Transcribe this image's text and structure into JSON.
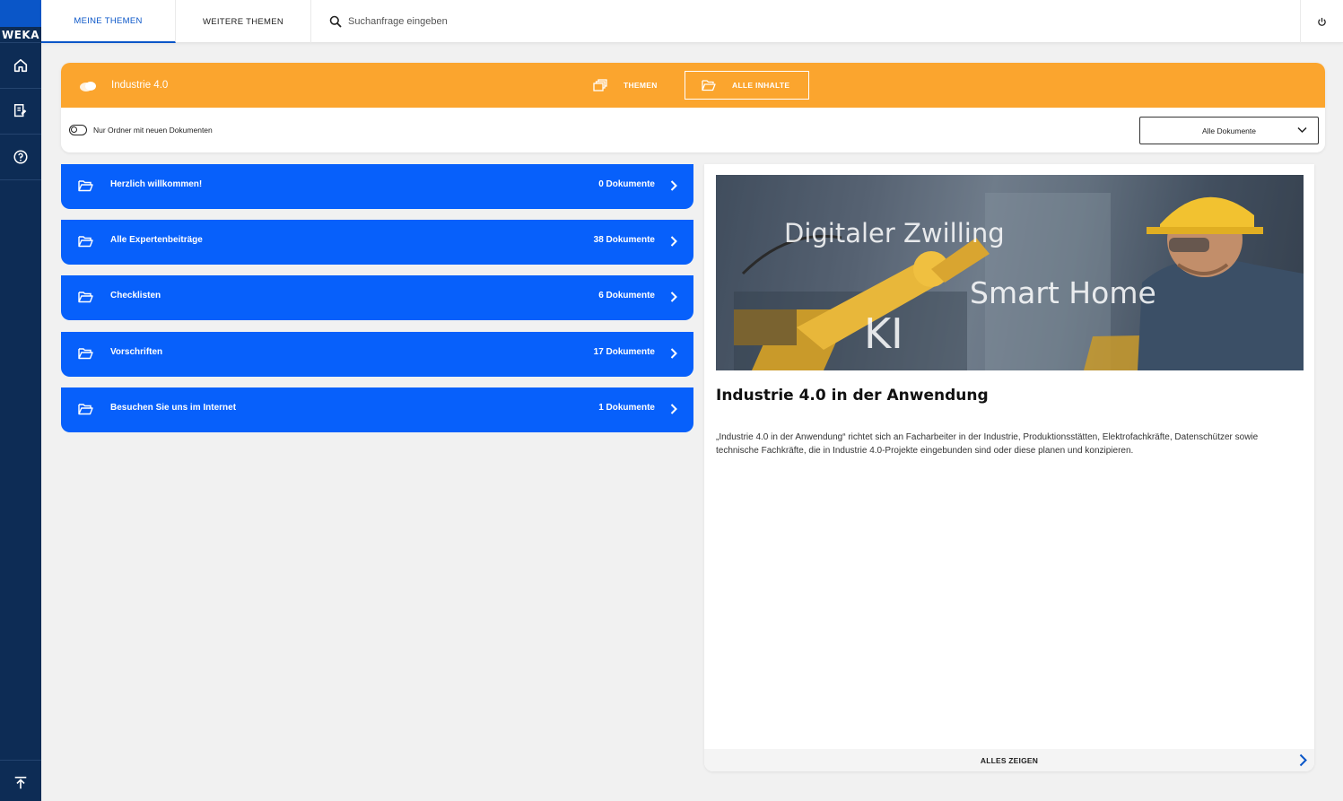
{
  "brand": {
    "logo_text": "WEKA"
  },
  "sidebar": {
    "items": [
      {
        "icon": "home-icon"
      },
      {
        "icon": "document-edit-icon"
      },
      {
        "icon": "help-icon"
      }
    ],
    "bottom_icon": "scroll-top-icon"
  },
  "topbar": {
    "tabs": [
      {
        "label": "MEINE THEMEN",
        "active": true
      },
      {
        "label": "WEITERE THEMEN",
        "active": false
      }
    ],
    "search_placeholder": "Suchanfrage eingeben",
    "power_icon": "power-icon"
  },
  "header": {
    "title": "Industrie 4.0",
    "themen_label": "THEMEN",
    "alle_inhalte_label": "ALLE INHALTE",
    "accent_color": "#fba52e"
  },
  "filter": {
    "toggle_label": "Nur Ordner mit neuen Dokumenten",
    "toggle_on": false,
    "dropdown_value": "Alle Dokumente"
  },
  "folders": [
    {
      "label": "Herzlich willkommen!",
      "count": "0 Dokumente"
    },
    {
      "label": "Alle Expertenbeiträge",
      "count": "38 Dokumente"
    },
    {
      "label": "Checklisten",
      "count": "6 Dokumente"
    },
    {
      "label": "Vorschriften",
      "count": "17 Dokumente"
    },
    {
      "label": "Besuchen Sie uns im Internet",
      "count": "1 Dokumente"
    }
  ],
  "folder_color": "#0760fb",
  "detail": {
    "image_words": [
      "Digitaler Zwilling",
      "Smart Home",
      "KI"
    ],
    "title": "Industrie 4.0 in der Anwendung",
    "description": "„Industrie 4.0 in der Anwendung“ richtet sich an Facharbeiter in der Industrie, Produktionsstätten, Elektrofachkräfte, Datenschützer sowie technische Fachkräfte, die in Industrie 4.0-Projekte eingebunden sind oder diese planen und konzipieren.",
    "footer_label": "ALLES ZEIGEN"
  },
  "colors": {
    "sidebar": "#0d2c55",
    "accent_blue": "#0a56c8"
  }
}
